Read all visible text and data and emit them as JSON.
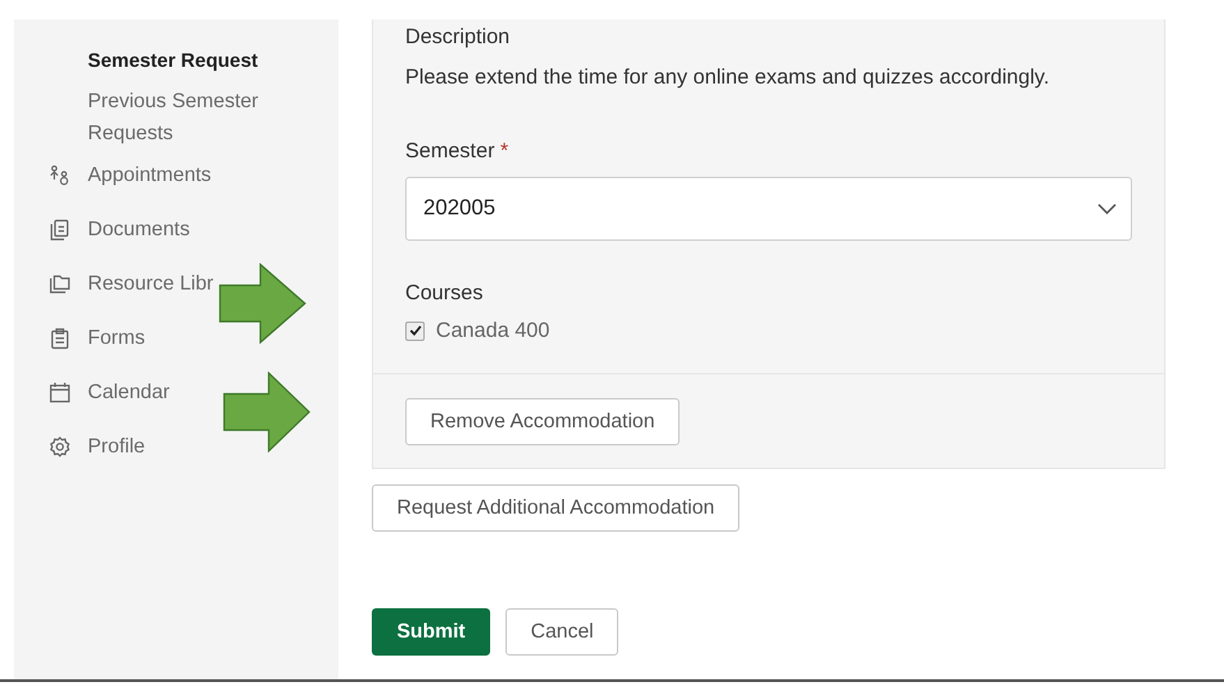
{
  "sidebar": {
    "items": [
      {
        "kind": "subitem",
        "label": "Semester Request",
        "selected": true
      },
      {
        "kind": "subitem",
        "label": "Previous Semester Requests",
        "selected": false
      },
      {
        "kind": "item",
        "label": "Appointments",
        "selected": false
      },
      {
        "kind": "item",
        "label": "Documents",
        "selected": false
      },
      {
        "kind": "item",
        "label": "Resource Libr",
        "selected": false
      },
      {
        "kind": "item",
        "label": "Forms",
        "selected": false
      },
      {
        "kind": "item",
        "label": "Calendar",
        "selected": false
      },
      {
        "kind": "item",
        "label": "Profile",
        "selected": false
      }
    ]
  },
  "accommodation": {
    "description_label": "Description",
    "description": "Please extend the time for any online exams and quizzes accordingly.",
    "semester": {
      "label": "Semester",
      "required": true,
      "required_mark": "*",
      "value": "202005"
    },
    "courses": {
      "label": "Courses",
      "items": [
        {
          "label": "Canada 400",
          "checked": true
        }
      ]
    },
    "remove_button": "Remove Accommodation"
  },
  "request_button": "Request Additional Accommodation",
  "actions": [
    {
      "kind": "primary",
      "label": "Submit"
    },
    {
      "kind": "secondary",
      "label": "Cancel"
    }
  ]
}
